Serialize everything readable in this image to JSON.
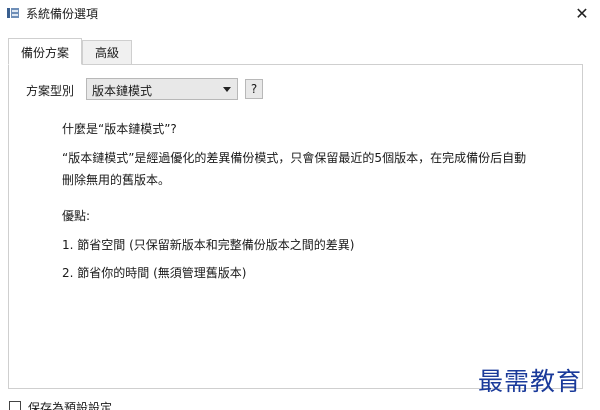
{
  "window": {
    "title": "系統備份選項",
    "close_symbol": "✕",
    "app_icon": "backup-app-icon"
  },
  "tabs": [
    {
      "label": "備份方案",
      "active": true
    },
    {
      "label": "高級",
      "active": false
    }
  ],
  "scheme": {
    "label": "方案型別",
    "selected": "版本鏈模式",
    "help_label": "?"
  },
  "description": {
    "question": "什麼是“版本鏈模式”?",
    "explanation": "“版本鏈模式”是經過優化的差異備份模式，只會保留最近的5個版本，在完成備份后自動刪除無用的舊版本。",
    "advantages_title": "優點:",
    "advantage_1": "1. 節省空間 (只保留新版本和完整備份版本之間的差異)",
    "advantage_2": "2. 節省你的時間 (無須管理舊版本)"
  },
  "footer": {
    "checkbox_label": "保存為預設設定",
    "checked": false
  },
  "watermark": "最需教育",
  "colors": {
    "watermark": "#1a3a9a",
    "tab_border": "#cfcfcf",
    "button_bg": "#e8e8e8"
  }
}
